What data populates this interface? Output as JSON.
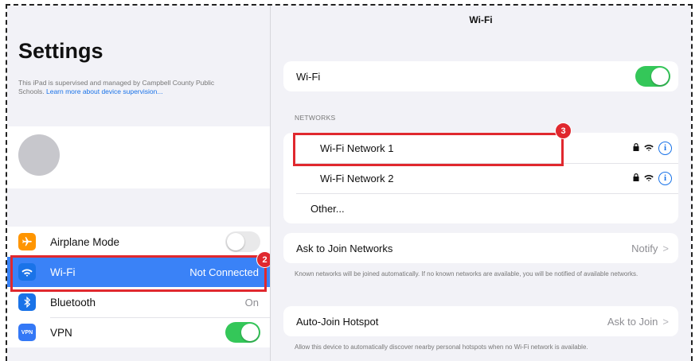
{
  "sidebar": {
    "title": "Settings",
    "note": "This iPad is supervised and managed by Campbell County Public Schools.",
    "note_link": "Learn more about device supervision...",
    "items": [
      {
        "label": "Airplane Mode",
        "icon": "airplane-icon",
        "color": "#ff9500",
        "control": "toggle-off"
      },
      {
        "label": "Wi-Fi",
        "icon": "wifi-icon",
        "color": "#1a73e8",
        "value": "Not Connected",
        "selected": true
      },
      {
        "label": "Bluetooth",
        "icon": "bluetooth-icon",
        "color": "#1a73e8",
        "value": "On"
      },
      {
        "label": "VPN",
        "icon": "vpn-icon",
        "icon_text": "VPN",
        "color": "#3478f6",
        "control": "toggle-on"
      }
    ]
  },
  "main": {
    "title": "Wi-Fi",
    "wifi_row": {
      "label": "Wi-Fi",
      "toggle": "on"
    },
    "networks_header": "NETWORKS",
    "networks": [
      {
        "name": "Wi-Fi Network 1"
      },
      {
        "name": "Wi-Fi Network 2"
      }
    ],
    "other_label": "Other...",
    "ask_join": {
      "label": "Ask to Join Networks",
      "value": "Notify"
    },
    "ask_join_note": "Known networks will be joined automatically. If no known networks are available, you will be notified of available networks.",
    "auto_join": {
      "label": "Auto-Join Hotspot",
      "value": "Ask to Join"
    },
    "auto_join_note": "Allow this device to automatically discover nearby personal hotspots when no Wi-Fi network is available."
  },
  "annotations": {
    "badge_2": "2",
    "badge_3": "3",
    "color": "#e0282e"
  }
}
